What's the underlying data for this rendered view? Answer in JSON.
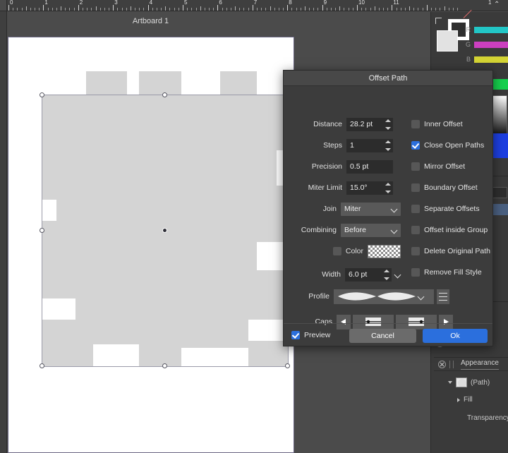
{
  "app": {
    "artboard_label": "Artboard 1",
    "ruler_labels": [
      "0",
      "1",
      "2",
      "3",
      "4",
      "5",
      "6",
      "7",
      "8",
      "9",
      "10",
      "11"
    ],
    "ruler_end_marker": "1"
  },
  "color_panel": {
    "channels": [
      {
        "label": "R",
        "color": "#22c6c6"
      },
      {
        "label": "G",
        "color": "#cc3fc0"
      },
      {
        "label": "B",
        "color": "#d4d434"
      }
    ]
  },
  "appearance": {
    "title": "Appearance",
    "rows": [
      {
        "label": "(Path)"
      },
      {
        "label": "Fill"
      },
      {
        "label": "Transparency"
      }
    ]
  },
  "dialog": {
    "title": "Offset Path",
    "fields": [
      {
        "label": "Distance",
        "value": "28.2 pt",
        "spinner": true
      },
      {
        "label": "Steps",
        "value": "1",
        "spinner": true
      },
      {
        "label": "Precision",
        "value": "0.5 pt",
        "spinner": false
      },
      {
        "label": "Miter Limit",
        "value": "15.0°",
        "spinner": true
      }
    ],
    "selects": [
      {
        "label": "Join",
        "value": "Miter"
      },
      {
        "label": "Combining",
        "value": "Before"
      }
    ],
    "color_row": {
      "label": "Color",
      "checked": false
    },
    "width_row": {
      "label": "Width",
      "value": "6.0 pt"
    },
    "profile_row": {
      "label": "Profile"
    },
    "caps_row": {
      "label": "Caps"
    },
    "checkboxes": [
      {
        "label": "Inner Offset",
        "checked": false
      },
      {
        "label": "Close Open Paths",
        "checked": true
      },
      {
        "label": "Mirror Offset",
        "checked": false
      },
      {
        "label": "Boundary Offset",
        "checked": false
      },
      {
        "label": "Separate Offsets",
        "checked": false
      },
      {
        "label": "Offset inside Group",
        "checked": false
      },
      {
        "label": "Delete Original Path",
        "checked": false
      },
      {
        "label": "Remove Fill Style",
        "checked": false
      }
    ],
    "footer": {
      "preview_label": "Preview",
      "preview_checked": true,
      "cancel_label": "Cancel",
      "ok_label": "Ok"
    },
    "accent_color": "#2b6fdd"
  }
}
